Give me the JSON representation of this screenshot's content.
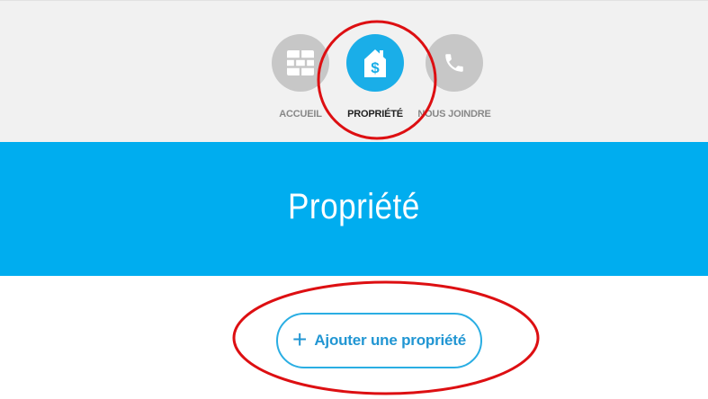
{
  "nav": {
    "items": [
      {
        "label": "ACCUEIL",
        "icon": "brick-wall-icon",
        "active": false
      },
      {
        "label": "PROPRIÉTÉ",
        "icon": "house-dollar-icon",
        "active": true
      },
      {
        "label": "NOUS JOINDRE",
        "icon": "phone-icon",
        "active": false
      }
    ]
  },
  "hero": {
    "title": "Propriété"
  },
  "actions": {
    "add_property_label": "Ajouter une propriété",
    "add_icon": "plus-icon"
  },
  "colors": {
    "accent": "#00adef",
    "nav_inactive": "#c7c7c7",
    "nav_background": "#f1f1f1",
    "annotation": "#dd0f12"
  }
}
